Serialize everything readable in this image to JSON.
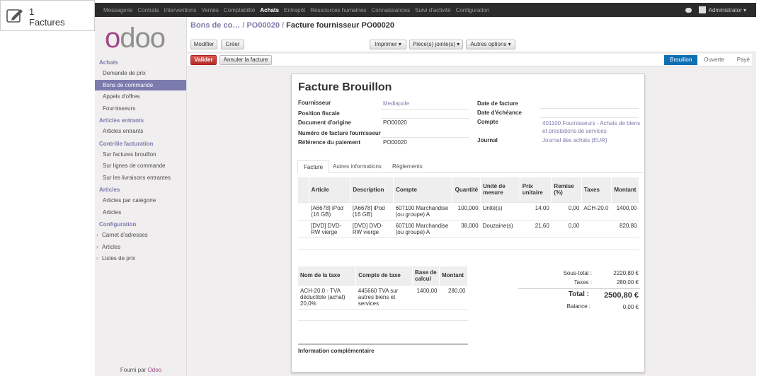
{
  "corner": {
    "count": "1",
    "label": "Factures"
  },
  "topnav": [
    "Messagerie",
    "Contrats",
    "Interventions",
    "Ventes",
    "Comptabilité",
    "Achats",
    "Entrepôt",
    "Ressources humaines",
    "Connaissances",
    "Suivi d'activité",
    "Configuration"
  ],
  "active_menu": "Achats",
  "user": "Administrator",
  "sidebar": {
    "sections": [
      {
        "title": "Achats",
        "items": [
          "Demande de prix",
          "Bons de commande",
          "Appels d'offres",
          "Fournisseurs"
        ]
      },
      {
        "title": "Articles entrants",
        "items": [
          "Articles entrants"
        ]
      },
      {
        "title": "Contrôle facturation",
        "items": [
          "Sur factures brouillon",
          "Sur lignes de commande",
          "Sur les livraisons entrantes"
        ]
      },
      {
        "title": "Articles",
        "items": [
          "Articles par catégorie",
          "Articles"
        ]
      },
      {
        "title": "Configuration",
        "items": [
          "Carnet d'adresses",
          "Articles",
          "Listes de prix"
        ]
      }
    ],
    "selected": "Bons de commande",
    "footer_prefix": "Fourni par",
    "footer_brand": "Odoo",
    "logo": "odoo"
  },
  "breadcrumb": {
    "part1": "Bons de co…",
    "sep1": " / ",
    "part2": "PO00020",
    "sep2": " / ",
    "current": "Facture fournisseur PO00020"
  },
  "buttons": {
    "edit": "Modifier",
    "create": "Créer",
    "print": "Imprimer ▾",
    "attachments": "Pièce(s) jointe(s) ▾",
    "more": "Autres options ▾",
    "validate": "Valider",
    "cancel": "Annuler la facture"
  },
  "stages": [
    "Brouillon",
    "Ouverte",
    "Payé"
  ],
  "current_stage": "Brouillon",
  "invoice": {
    "title": "Facture Brouillon",
    "fields": {
      "supplier_label": "Fournisseur",
      "supplier": "Mediapole",
      "fiscal_label": "Position fiscale",
      "origin_label": "Document d'origine",
      "origin": "PO00020",
      "supplier_inv_label": "Numéro de facture fournisseur",
      "payref_label": "Référence du paiement",
      "payref": "PO00020",
      "date_label": "Date de facture",
      "due_label": "Date d'échéance",
      "account_label": "Compte",
      "account": "401100 Fournisseurs - Achats de biens et prestations de services",
      "journal_label": "Journal",
      "journal": "Journal des achats (EUR)"
    },
    "tabs": [
      "Facture",
      "Autres informations",
      "Règlements"
    ],
    "lines_headers": [
      "Article",
      "Description",
      "Compte",
      "Quantité",
      "Unité de mesure",
      "Prix unitaire",
      "Remise (%)",
      "Taxes",
      "Montant"
    ],
    "lines": [
      [
        "[A6678] iPod (16 GB)",
        "[A6678] iPod (16 GB)",
        "607100 Marchandise (ou groupe) A",
        "100,000",
        "Unité(s)",
        "14,00",
        "0,00",
        "ACH-20.0",
        "1400,00"
      ],
      [
        "[DVD] DVD-RW vierge",
        "[DVD] DVD-RW vierge",
        "607100 Marchandise (ou groupe) A",
        "38,000",
        "Douzaine(s)",
        "21,60",
        "0,00",
        "",
        "820,80"
      ]
    ],
    "tax_headers": [
      "Nom de la taxe",
      "Compte de taxe",
      "Base de calcul",
      "Montant"
    ],
    "tax_lines": [
      [
        "ACH-20.0 - TVA déductible (achat) 20,0%",
        "445660 TVA sur autres biens et services",
        "1400,00",
        "280,00"
      ]
    ],
    "totals": {
      "subtotal_label": "Sous-total :",
      "subtotal": "2220,80 €",
      "taxes_label": "Taxes :",
      "taxes": "280,00 €",
      "total_label": "Total :",
      "total": "2500,80 €",
      "balance_label": "Balance :",
      "balance": "0,00 €"
    },
    "info_label": "Information complémentaire"
  }
}
